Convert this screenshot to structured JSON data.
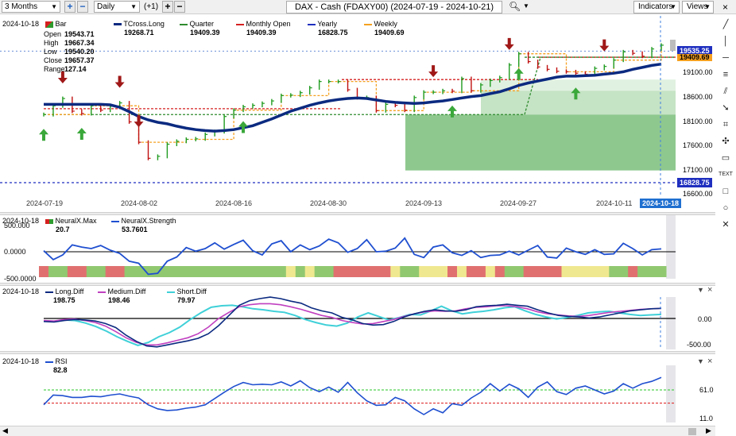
{
  "toolbar": {
    "period": "3 Months",
    "interval": "Daily",
    "offset": "(+1)",
    "title": "DAX - Cash (FDAXY00) (2024-07-19 - 2024-10-21)",
    "indicators_label": "Indicators",
    "views_label": "Views"
  },
  "price_panel": {
    "date": "2024-10-18",
    "legend": [
      {
        "name": "Bar",
        "value": ""
      },
      {
        "name": "TCross.Long",
        "value": "19268.71"
      },
      {
        "name": "Quarter",
        "value": "19409.39"
      },
      {
        "name": "Monthly Open",
        "value": "19409.39"
      },
      {
        "name": "Yearly",
        "value": "16828.75"
      },
      {
        "name": "Weekly",
        "value": "19409.69"
      }
    ],
    "ohlc": [
      {
        "label": "Open",
        "value": "19543.71"
      },
      {
        "label": "High",
        "value": "19667.34"
      },
      {
        "label": "Low",
        "value": "19540.20"
      },
      {
        "label": "Close",
        "value": "19657.37"
      },
      {
        "label": "Range",
        "value": "127.14"
      }
    ],
    "y_ticks": [
      "19100.00",
      "18600.00",
      "18100.00",
      "17600.00",
      "17100.00",
      "16600.00"
    ],
    "price_tag_last": "19535.25",
    "price_tag_weekly": "19409.69",
    "price_tag_yearly": "16828.75",
    "x_ticks": [
      "2024-07-19",
      "2024-08-02",
      "2024-08-16",
      "2024-08-30",
      "2024-09-13",
      "2024-09-27",
      "2024-10-11",
      "2024-10-18"
    ]
  },
  "neuralx_panel": {
    "date": "2024-10-18",
    "legend": [
      {
        "name": "NeuralX.Max",
        "value": "20.7"
      },
      {
        "name": "NeuralX.Strength",
        "value": "53.7601"
      }
    ],
    "y_ticks": [
      "500.000",
      "0.0000",
      "-500.0000"
    ]
  },
  "diff_panel": {
    "date": "2024-10-18",
    "legend": [
      {
        "name": "Long.Diff",
        "value": "198.75"
      },
      {
        "name": "Medium.Diff",
        "value": "198.46"
      },
      {
        "name": "Short.Diff",
        "value": "79.97"
      }
    ],
    "y_ticks": [
      "0.00",
      "-500.00"
    ]
  },
  "rsi_panel": {
    "date": "2024-10-18",
    "legend": [
      {
        "name": "RSI",
        "value": "82.8"
      }
    ],
    "y_ticks": [
      "61.0",
      "11.0"
    ]
  },
  "colors": {
    "tcross": "#0b2a80",
    "quarter": "#2e8b2e",
    "monthly": "#d62020",
    "yearly": "#1f2fbf",
    "weekly": "#f5a020",
    "neural_line": "#1f4fd0",
    "long_diff": "#0b2a80",
    "medium_diff": "#c040c0",
    "short_diff": "#3fd0d8",
    "rsi": "#1f4fd0"
  },
  "chart_data": [
    {
      "type": "bar",
      "panel": "price",
      "title": "DAX - Cash (FDAXY00) (2024-07-19 - 2024-10-21)",
      "x": [
        "2024-07-19",
        "2024-07-22",
        "2024-07-23",
        "2024-07-24",
        "2024-07-25",
        "2024-07-26",
        "2024-07-29",
        "2024-07-30",
        "2024-07-31",
        "2024-08-01",
        "2024-08-02",
        "2024-08-05",
        "2024-08-06",
        "2024-08-07",
        "2024-08-08",
        "2024-08-09",
        "2024-08-12",
        "2024-08-13",
        "2024-08-14",
        "2024-08-15",
        "2024-08-16",
        "2024-08-19",
        "2024-08-20",
        "2024-08-21",
        "2024-08-22",
        "2024-08-23",
        "2024-08-26",
        "2024-08-27",
        "2024-08-28",
        "2024-08-29",
        "2024-08-30",
        "2024-09-02",
        "2024-09-03",
        "2024-09-04",
        "2024-09-05",
        "2024-09-06",
        "2024-09-09",
        "2024-09-10",
        "2024-09-11",
        "2024-09-12",
        "2024-09-13",
        "2024-09-16",
        "2024-09-17",
        "2024-09-18",
        "2024-09-19",
        "2024-09-20",
        "2024-09-23",
        "2024-09-24",
        "2024-09-25",
        "2024-09-26",
        "2024-09-27",
        "2024-09-30",
        "2024-10-01",
        "2024-10-02",
        "2024-10-03",
        "2024-10-04",
        "2024-10-07",
        "2024-10-08",
        "2024-10-09",
        "2024-10-10",
        "2024-10-11",
        "2024-10-14",
        "2024-10-15",
        "2024-10-16",
        "2024-10-17",
        "2024-10-18"
      ],
      "close": [
        18230,
        18410,
        18560,
        18300,
        18250,
        18410,
        18320,
        18400,
        18470,
        18080,
        17660,
        17330,
        17370,
        17620,
        17680,
        17720,
        17730,
        17820,
        17880,
        18190,
        18320,
        18390,
        18420,
        18460,
        18510,
        18620,
        18630,
        18680,
        18780,
        18910,
        18910,
        18910,
        18740,
        18580,
        18580,
        18310,
        18440,
        18420,
        18320,
        18580,
        18690,
        18690,
        18720,
        18710,
        18970,
        18720,
        18840,
        18930,
        18990,
        19250,
        19480,
        19320,
        19210,
        19160,
        19120,
        19110,
        19080,
        19060,
        19180,
        19220,
        19350,
        19520,
        19490,
        19430,
        19580,
        19657
      ],
      "tcross_long": [
        18440,
        18440,
        18440,
        18440,
        18440,
        18440,
        18440,
        18430,
        18380,
        18290,
        18190,
        18120,
        18070,
        18040,
        17990,
        17950,
        17920,
        17900,
        17890,
        17900,
        17920,
        17960,
        18000,
        18070,
        18140,
        18220,
        18300,
        18360,
        18420,
        18470,
        18510,
        18540,
        18560,
        18570,
        18560,
        18530,
        18500,
        18480,
        18470,
        18460,
        18470,
        18490,
        18510,
        18540,
        18570,
        18600,
        18620,
        18660,
        18700,
        18760,
        18830,
        18880,
        18920,
        18960,
        19000,
        19020,
        19020,
        19030,
        19040,
        19060,
        19080,
        19110,
        19160,
        19200,
        19240,
        19269
      ],
      "quarter": 19409.39,
      "monthly_open": 19409.39,
      "yearly": 16828.75,
      "weekly": 19409.69,
      "ylim": [
        16600,
        19700
      ]
    },
    {
      "type": "line",
      "panel": "neuralx",
      "series": [
        {
          "name": "NeuralX.Strength",
          "values": [
            20,
            -150,
            -60,
            130,
            90,
            60,
            120,
            30,
            -30,
            -180,
            -220,
            -430,
            -410,
            -180,
            -100,
            80,
            10,
            60,
            170,
            50,
            140,
            220,
            20,
            -60,
            150,
            210,
            0,
            130,
            40,
            110,
            240,
            170,
            -10,
            60,
            230,
            0,
            10,
            70,
            260,
            -50,
            -110,
            90,
            130,
            -20,
            -70,
            20,
            -110,
            -70,
            -60,
            10,
            -60,
            30,
            120,
            -100,
            -120,
            70,
            0,
            -50,
            40,
            -50,
            -40,
            160,
            60,
            -60,
            40,
            54
          ]
        }
      ],
      "ylim": [
        -500,
        500
      ]
    },
    {
      "type": "line",
      "panel": "diff",
      "series": [
        {
          "name": "Long.Diff",
          "values": [
            -60,
            -70,
            -40,
            -20,
            -30,
            -50,
            -100,
            -180,
            -330,
            -450,
            -540,
            -560,
            -520,
            -480,
            -440,
            -390,
            -300,
            -140,
            60,
            260,
            350,
            390,
            420,
            390,
            340,
            300,
            210,
            150,
            110,
            20,
            -30,
            -100,
            -130,
            -120,
            -60,
            30,
            90,
            140,
            170,
            150,
            140,
            170,
            230,
            250,
            260,
            280,
            260,
            240,
            170,
            110,
            60,
            40,
            30,
            10,
            30,
            70,
            110,
            150,
            170,
            190,
            199
          ]
        },
        {
          "name": "Medium.Diff",
          "values": [
            -40,
            -50,
            -20,
            -10,
            -40,
            -80,
            -150,
            -260,
            -380,
            -470,
            -520,
            -520,
            -480,
            -430,
            -380,
            -300,
            -170,
            0,
            120,
            230,
            270,
            290,
            290,
            270,
            230,
            180,
            120,
            60,
            20,
            -40,
            -80,
            -110,
            -100,
            -60,
            -20,
            40,
            90,
            130,
            150,
            140,
            150,
            190,
            220,
            230,
            250,
            250,
            230,
            190,
            130,
            90,
            70,
            50,
            40,
            60,
            90,
            120,
            140,
            160,
            180,
            190,
            198
          ]
        },
        {
          "name": "Short.Diff",
          "values": [
            -50,
            -60,
            -30,
            -40,
            -90,
            -160,
            -250,
            -360,
            -450,
            -530,
            -470,
            -360,
            -280,
            -170,
            -20,
            110,
            220,
            250,
            260,
            230,
            190,
            170,
            140,
            120,
            60,
            -20,
            -80,
            -130,
            -150,
            -90,
            30,
            110,
            40,
            -30,
            20,
            80,
            70,
            150,
            240,
            150,
            90,
            120,
            140,
            170,
            210,
            230,
            150,
            80,
            30,
            -10,
            20,
            60,
            110,
            130,
            140,
            110,
            80,
            60,
            70,
            80
          ]
        }
      ],
      "ylim": [
        -560,
        460
      ]
    },
    {
      "type": "line",
      "panel": "rsi",
      "series": [
        {
          "name": "RSI",
          "values": [
            35,
            52,
            51,
            48,
            48,
            50,
            49,
            52,
            54,
            50,
            47,
            35,
            28,
            25,
            26,
            29,
            31,
            35,
            46,
            57,
            67,
            74,
            70,
            71,
            70,
            75,
            68,
            77,
            65,
            58,
            66,
            57,
            74,
            56,
            42,
            34,
            35,
            48,
            42,
            28,
            18,
            28,
            21,
            37,
            34,
            47,
            57,
            72,
            59,
            71,
            63,
            48,
            66,
            75,
            58,
            53,
            64,
            68,
            61,
            54,
            59,
            72,
            64,
            72,
            76,
            83
          ]
        }
      ],
      "ylim": [
        0,
        100
      ],
      "reference_lines": [
        61,
        38
      ]
    }
  ]
}
